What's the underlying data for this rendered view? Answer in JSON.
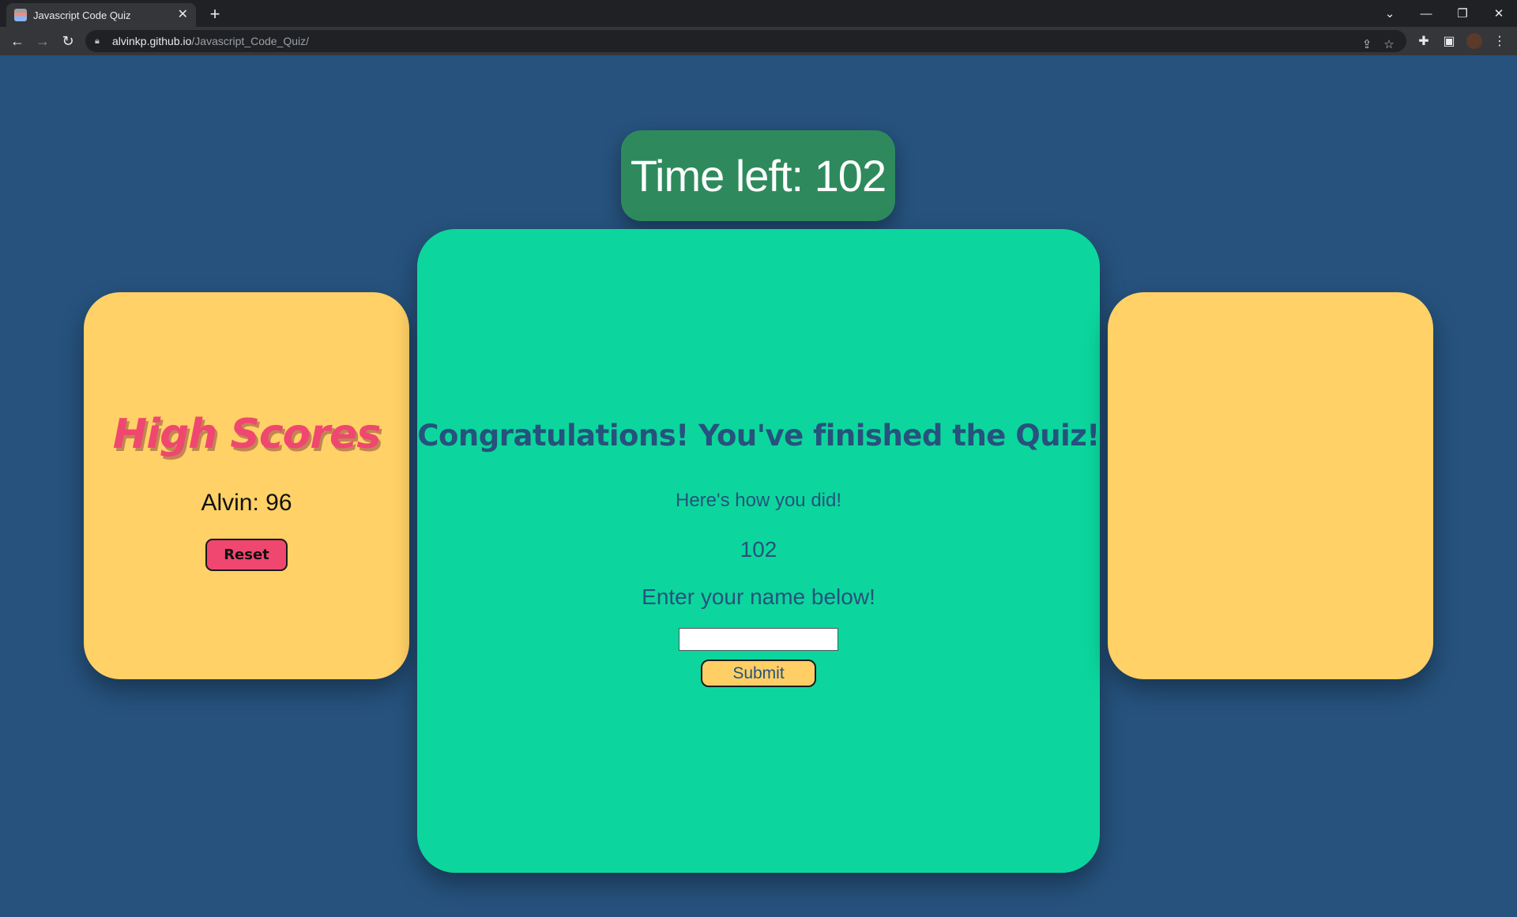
{
  "browser": {
    "tab_title": "Javascript Code Quiz",
    "url_host": "alvinkp.github.io",
    "url_path": "/Javascript_Code_Quiz/"
  },
  "timer": {
    "text": "Time left: 102"
  },
  "quiz": {
    "heading": "Congratulations! You've finished the Quiz!",
    "subheading": "Here's how you did!",
    "score": "102",
    "prompt": "Enter your name below!",
    "name_input_value": "",
    "submit_label": "Submit"
  },
  "high_scores": {
    "title": "High Scores",
    "entries": [
      "Alvin: 96"
    ],
    "reset_label": "Reset"
  },
  "colors": {
    "background": "#26527d",
    "timer_bg": "#2e8a5c",
    "main_card": "#0cd69d",
    "side_card": "#ffd166",
    "accent_pink": "#ef476f"
  }
}
